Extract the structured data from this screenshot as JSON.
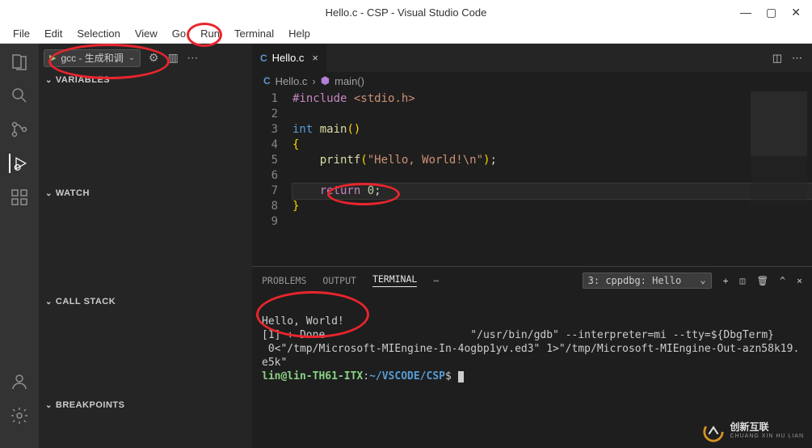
{
  "window": {
    "title": "Hello.c - CSP - Visual Studio Code"
  },
  "menu": {
    "file": "File",
    "edit": "Edit",
    "selection": "Selection",
    "view": "View",
    "go": "Go",
    "run": "Run",
    "terminal": "Terminal",
    "help": "Help"
  },
  "debug": {
    "run_config": "gcc - 生成和调",
    "sections": {
      "variables": "Variables",
      "watch": "Watch",
      "callstack": "Call Stack",
      "breakpoints": "Breakpoints"
    }
  },
  "tab": {
    "name": "Hello.c"
  },
  "breadcrumb": {
    "file": "Hello.c",
    "symbol": "main()"
  },
  "code": {
    "lines": [
      {
        "n": "1",
        "t": "#include",
        "a": "<stdio.h>"
      },
      {
        "n": "2"
      },
      {
        "n": "3",
        "kw": "int",
        "fn": "main",
        "br": "()"
      },
      {
        "n": "4",
        "b": "{"
      },
      {
        "n": "5",
        "fn": "printf",
        "open": "(",
        "str": "\"Hello, World!\\n\"",
        "close": ");"
      },
      {
        "n": "6"
      },
      {
        "n": "7",
        "ret": "return",
        "num": "0",
        "semi": ";"
      },
      {
        "n": "8",
        "b": "}"
      },
      {
        "n": "9"
      }
    ]
  },
  "panel": {
    "tabs": {
      "problems": "PROBLEMS",
      "output": "OUTPUT",
      "terminal": "TERMINAL"
    },
    "select": "3: cppdbg: Hello",
    "out_hello": "Hello, World!",
    "out_done": "[1] + Done",
    "out_gdb": "\"/usr/bin/gdb\" --interpreter=mi --tty=${DbgTerm}",
    "out_rest": " 0<\"/tmp/Microsoft-MIEngine-In-4ogbp1yv.ed3\" 1>\"/tmp/Microsoft-MIEngine-Out-azn58k19.e5k\"",
    "prompt_user": "lin@lin-TH61-ITX",
    "prompt_sep": ":",
    "prompt_path": "~/VSCODE/CSP",
    "prompt_end": "$ "
  },
  "watermark": {
    "brand": "创新互联",
    "sub": "CHUANG XIN HU LIAN"
  }
}
